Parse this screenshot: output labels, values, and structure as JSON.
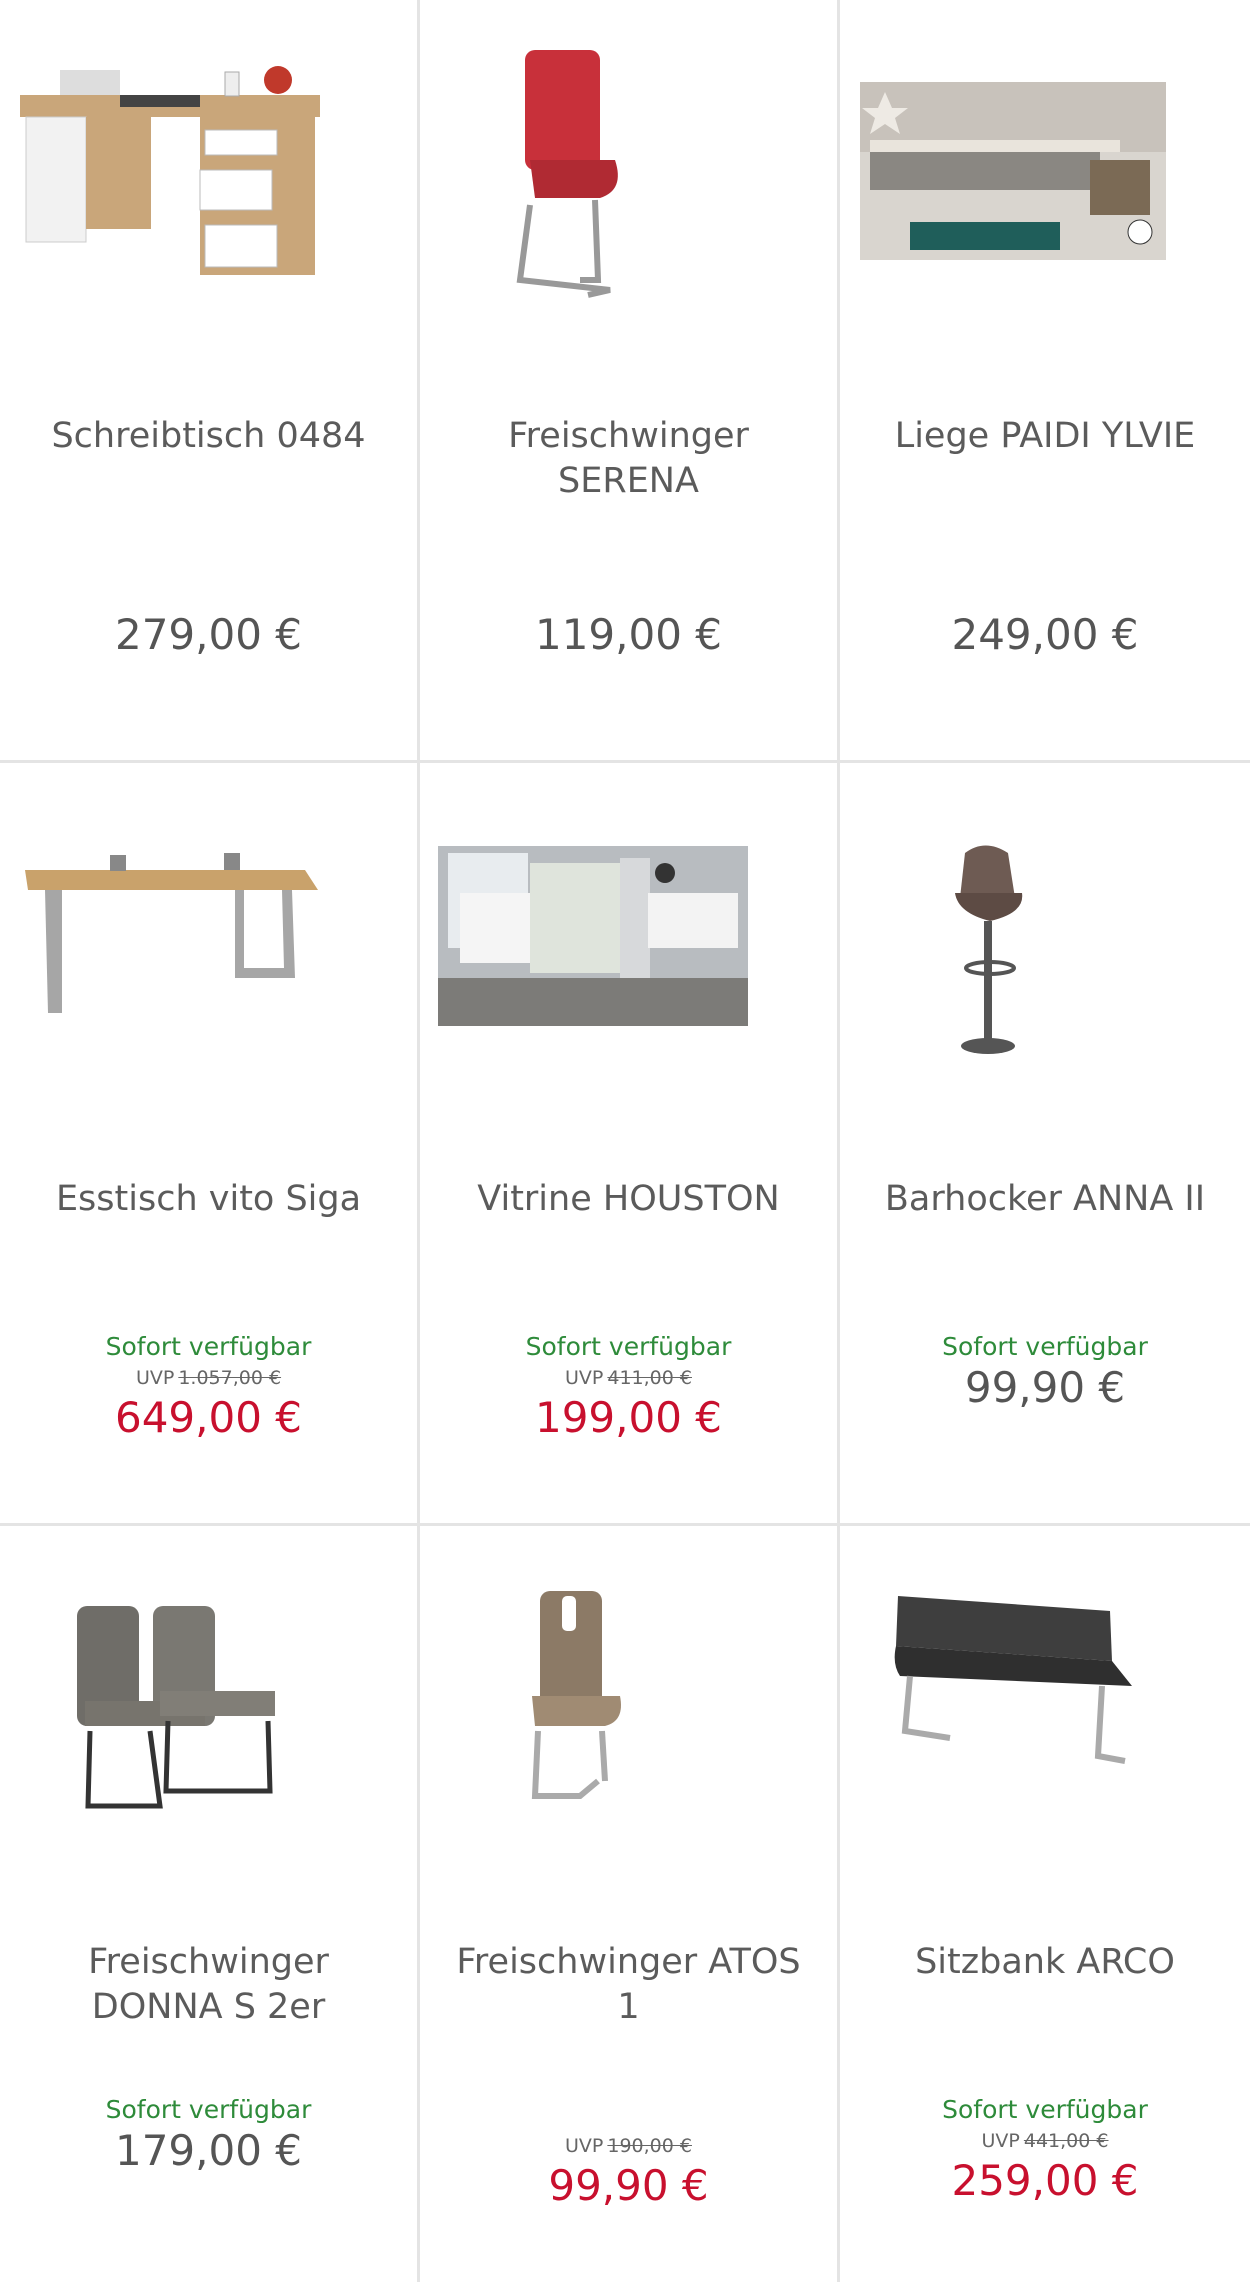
{
  "colors": {
    "available": "#2e8b3a",
    "sale_price": "#c8102e",
    "regular_price": "#555555",
    "divider": "#e4e4e4"
  },
  "products": [
    {
      "title": "Schreibtisch 0484",
      "price": "279,00 €",
      "image": "desk-image"
    },
    {
      "title": "Freischwinger SERENA",
      "price": "119,00 €",
      "image": "red-chair-image"
    },
    {
      "title": "Liege PAIDI YLVIE",
      "price": "249,00 €",
      "image": "kids-bed-image"
    },
    {
      "title": "Esstisch vito Siga",
      "availability": "Sofort verfügbar",
      "uvp_label": "UVP",
      "uvp": "1.057,00 €",
      "price": "649,00 €",
      "image": "dining-table-image"
    },
    {
      "title": "Vitrine HOUSTON",
      "availability": "Sofort verfügbar",
      "uvp_label": "UVP",
      "uvp": "411,00 €",
      "price": "199,00 €",
      "image": "living-room-image"
    },
    {
      "title": "Barhocker ANNA II",
      "availability": "Sofort verfügbar",
      "price": "99,90 €",
      "image": "bar-stool-image"
    },
    {
      "title": "Freischwinger DONNA S 2er",
      "availability": "Sofort verfügbar",
      "price": "179,00 €",
      "image": "grey-chairs-image"
    },
    {
      "title": "Freischwinger ATOS 1",
      "uvp_label": "UVP",
      "uvp": "190,00 €",
      "price": "99,90 €",
      "image": "beige-chair-image"
    },
    {
      "title": "Sitzbank ARCO",
      "availability": "Sofort verfügbar",
      "uvp_label": "UVP",
      "uvp": "441,00 €",
      "price": "259,00 €",
      "image": "bench-image"
    }
  ]
}
